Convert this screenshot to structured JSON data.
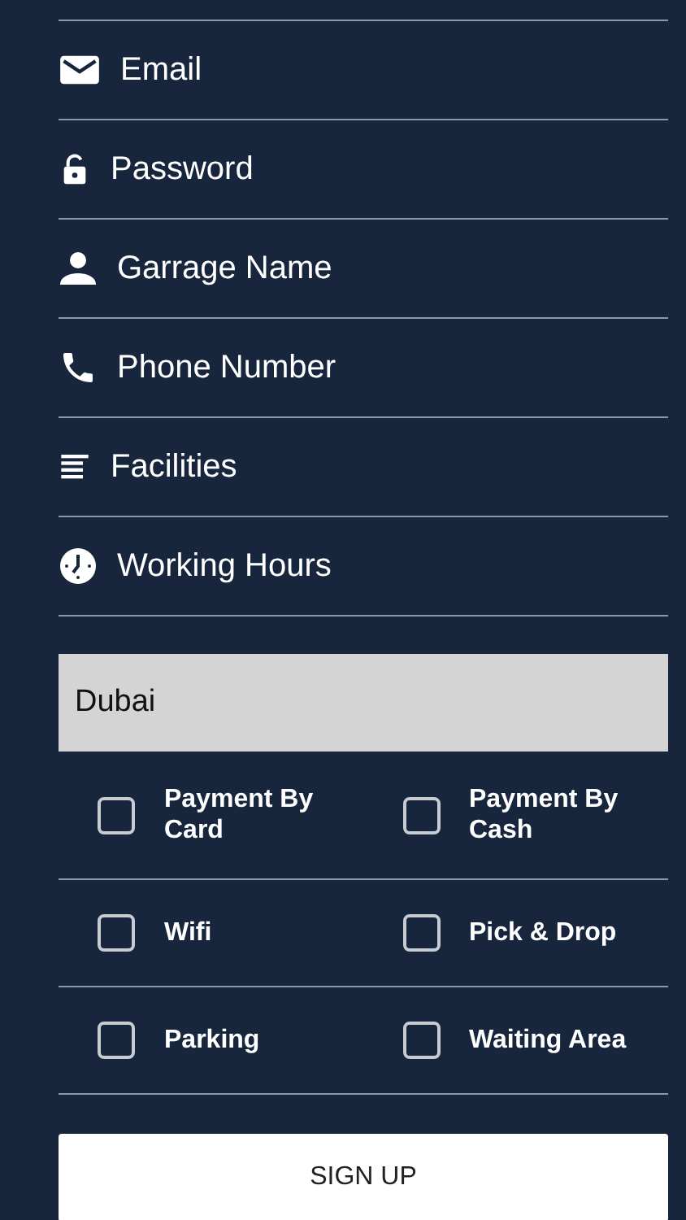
{
  "fields": [
    {
      "kind": "email",
      "placeholder": "Email"
    },
    {
      "kind": "password",
      "placeholder": "Password"
    },
    {
      "kind": "name",
      "placeholder": "Garrage Name"
    },
    {
      "kind": "phone",
      "placeholder": "Phone Number"
    },
    {
      "kind": "facilities",
      "placeholder": "Facilities"
    },
    {
      "kind": "hours",
      "placeholder": "Working Hours"
    }
  ],
  "city": {
    "value": "Dubai"
  },
  "options": [
    {
      "label": "Payment By Card",
      "checked": false
    },
    {
      "label": "Payment By Cash",
      "checked": false
    },
    {
      "label": "Wifi",
      "checked": false
    },
    {
      "label": "Pick & Drop",
      "checked": false
    },
    {
      "label": "Parking",
      "checked": false
    },
    {
      "label": "Waiting Area",
      "checked": false
    }
  ],
  "submit": {
    "label": "SIGN UP"
  }
}
